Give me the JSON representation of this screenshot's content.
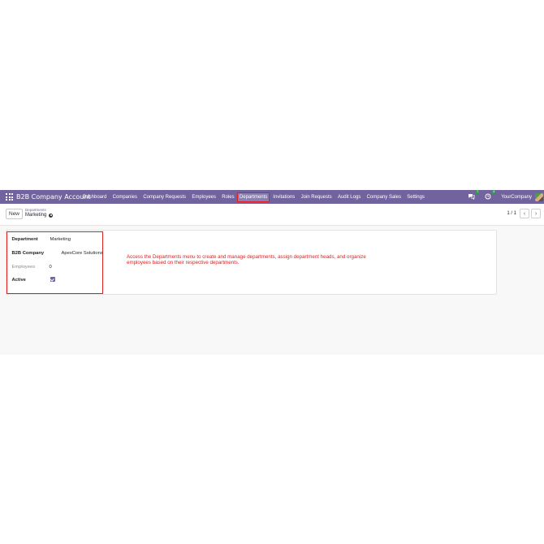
{
  "navbar": {
    "brand": "B2B Company Account",
    "menu": [
      "Dashboard",
      "Companies",
      "Company Requests",
      "Employees",
      "Roles",
      "Departments",
      "Invitations",
      "Join Requests",
      "Audit Logs",
      "Company Sales",
      "Settings"
    ],
    "active_menu": "Departments",
    "chat_badge": "7",
    "activity_badge": "4",
    "company": "YourCompany"
  },
  "control": {
    "new_label": "New",
    "breadcrumb_parent": "Departments",
    "breadcrumb_current": "Marketing",
    "pager": "1 / 1"
  },
  "form": {
    "department_label": "Department",
    "department_value": "Marketing",
    "company_label": "B2B Company",
    "company_value": "ApexCore Solutions",
    "employees_label": "Employees",
    "employees_value": "0",
    "active_label": "Active",
    "active_checked": true
  },
  "annotation": "Access the Departments menu to create and manage departments, assign department heads, and organize employees based on their respective departments.",
  "colors": {
    "navbar": "#71639e",
    "highlight": "#e02020"
  }
}
